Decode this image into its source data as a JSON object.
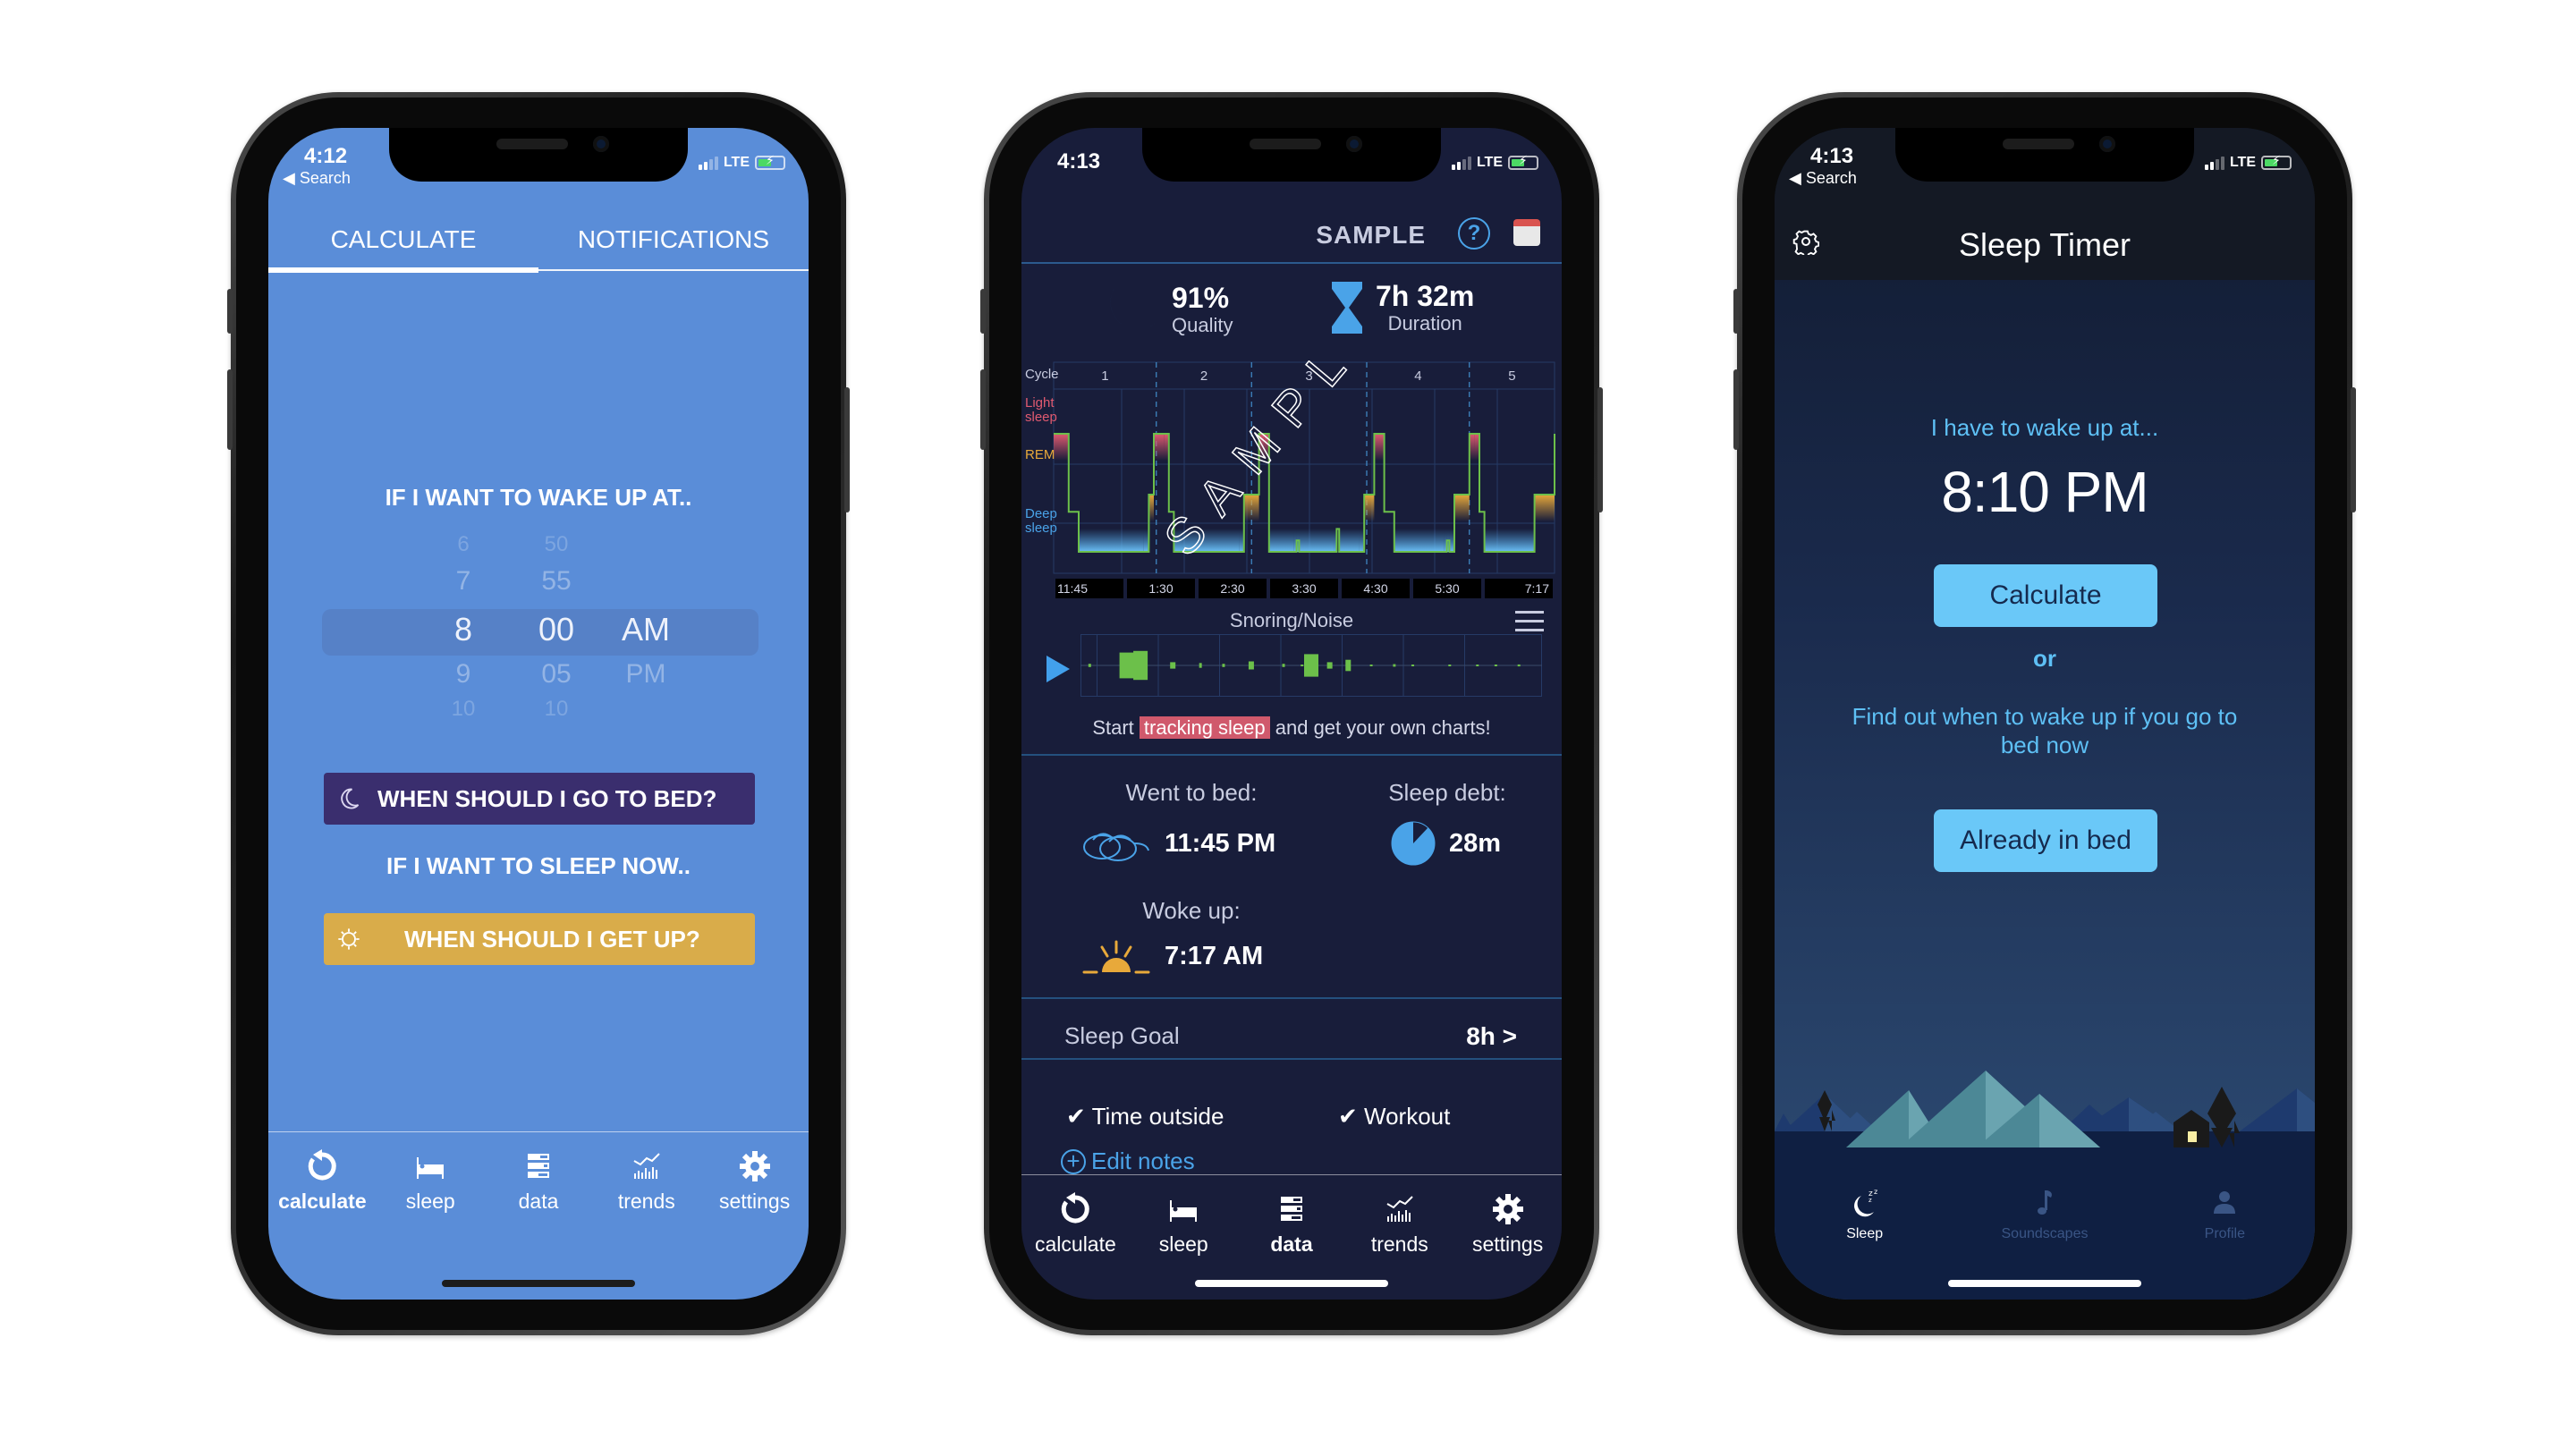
{
  "phones": {
    "calculator": {
      "status": {
        "time": "4:12",
        "back": "◀ Search",
        "network": "LTE"
      },
      "tabs": [
        {
          "label": "CALCULATE",
          "active": true
        },
        {
          "label": "NOTIFICATIONS",
          "active": false
        }
      ],
      "wake_heading": "IF I WANT TO WAKE UP AT..",
      "picker": {
        "hours": [
          "6",
          "7",
          "8",
          "9",
          "10"
        ],
        "minutes": [
          "50",
          "55",
          "00",
          "05",
          "10"
        ],
        "period": [
          "AM",
          "PM"
        ],
        "selected": {
          "hour": "8",
          "minute": "00",
          "period": "AM"
        }
      },
      "bed_button": "WHEN SHOULD I GO TO BED?",
      "sleep_now_heading": "IF I WANT TO SLEEP NOW..",
      "getup_button": "WHEN SHOULD I GET UP?",
      "colors": {
        "background": "#5a8dd8",
        "bed_button": "#3a2e6e",
        "getup_button": "#d9ac4a"
      },
      "tabbar": [
        {
          "label": "calculate",
          "icon": "refresh-icon",
          "active": true
        },
        {
          "label": "sleep",
          "icon": "bed-icon",
          "active": false
        },
        {
          "label": "data",
          "icon": "data-icon",
          "active": false
        },
        {
          "label": "trends",
          "icon": "trends-icon",
          "active": false
        },
        {
          "label": "settings",
          "icon": "gear-icon",
          "active": false
        }
      ]
    },
    "data": {
      "status": {
        "time": "4:13",
        "network": "LTE"
      },
      "title": "SAMPLE",
      "help": "?",
      "quality": {
        "value": "91%",
        "label": "Quality"
      },
      "duration": {
        "value": "7h 32m",
        "label": "Duration"
      },
      "hypnogram": {
        "cycle_label": "Cycle",
        "cycles": [
          "1",
          "2",
          "3",
          "4",
          "5"
        ],
        "stage_labels": [
          {
            "label": "Light\nsleep",
            "line1": "Light",
            "line2": "sleep",
            "color": "#e05a70"
          },
          {
            "label": "REM",
            "line1": "REM",
            "line2": "",
            "color": "#e8a93a"
          },
          {
            "label": "Deep\nsleep",
            "line1": "Deep",
            "line2": "sleep",
            "color": "#4aa3e8"
          }
        ],
        "time_ticks": [
          "11:45",
          "1:30",
          "2:30",
          "3:30",
          "4:30",
          "5:30",
          "7:17"
        ],
        "watermark": "SAMPLE",
        "stages": [
          [
            0,
            0
          ],
          [
            0.03,
            1.3
          ],
          [
            0.05,
            2
          ],
          [
            0.18,
            2
          ],
          [
            0.19,
            1
          ],
          [
            0.2,
            0
          ],
          [
            0.22,
            0
          ],
          [
            0.23,
            1.3
          ],
          [
            0.24,
            2
          ],
          [
            0.37,
            2
          ],
          [
            0.38,
            1
          ],
          [
            0.41,
            0
          ],
          [
            0.42,
            0
          ],
          [
            0.43,
            2
          ],
          [
            0.48,
            2
          ],
          [
            0.485,
            1.8
          ],
          [
            0.49,
            2
          ],
          [
            0.56,
            2
          ],
          [
            0.565,
            1.6
          ],
          [
            0.57,
            2
          ],
          [
            0.61,
            2
          ],
          [
            0.62,
            1
          ],
          [
            0.64,
            0
          ],
          [
            0.65,
            0
          ],
          [
            0.66,
            1.3
          ],
          [
            0.68,
            2
          ],
          [
            0.78,
            2
          ],
          [
            0.785,
            1.8
          ],
          [
            0.79,
            2
          ],
          [
            0.8,
            1
          ],
          [
            0.83,
            0
          ],
          [
            0.84,
            0
          ],
          [
            0.85,
            1.3
          ],
          [
            0.86,
            2
          ],
          [
            0.95,
            2
          ],
          [
            0.96,
            1
          ],
          [
            1.0,
            0
          ]
        ]
      },
      "snoring": {
        "label": "Snoring/Noise",
        "events": [
          0.02,
          0.1,
          0.13,
          0.2,
          0.26,
          0.31,
          0.37,
          0.44,
          0.48,
          0.5,
          0.54,
          0.58,
          0.63,
          0.68,
          0.72,
          0.8,
          0.86,
          0.9,
          0.95
        ],
        "amplitudes": [
          0.1,
          0.8,
          0.9,
          0.2,
          0.15,
          0.1,
          0.25,
          0.1,
          0.05,
          0.7,
          0.2,
          0.35,
          0.05,
          0.08,
          0.04,
          0.03,
          0.04,
          0.03,
          0.06
        ]
      },
      "cta": {
        "before": "Start ",
        "highlight": "tracking sleep",
        "after": " and get your own charts!"
      },
      "went_to_bed": {
        "label": "Went to bed:",
        "value": "11:45 PM"
      },
      "sleep_debt": {
        "label": "Sleep debt:",
        "value": "28m",
        "fraction": 0.88
      },
      "woke_up": {
        "label": "Woke up:",
        "value": "7:17 AM"
      },
      "sleep_goal": {
        "label": "Sleep Goal",
        "value": "8h >"
      },
      "notes": [
        {
          "check": "✔",
          "label": "Time outside"
        },
        {
          "check": "✔",
          "label": "Workout"
        }
      ],
      "edit_notes": "Edit notes",
      "tabbar": [
        {
          "label": "calculate",
          "icon": "refresh-icon",
          "active": false
        },
        {
          "label": "sleep",
          "icon": "bed-icon",
          "active": false
        },
        {
          "label": "data",
          "icon": "data-icon",
          "active": true
        },
        {
          "label": "trends",
          "icon": "trends-icon",
          "active": false
        },
        {
          "label": "settings",
          "icon": "gear-icon",
          "active": false
        }
      ]
    },
    "timer": {
      "status": {
        "time": "4:13",
        "back": "◀ Search",
        "network": "LTE"
      },
      "title": "Sleep Timer",
      "wake_prompt": "I have to wake up at...",
      "wake_time": "8:10 PM",
      "calculate_button": "Calculate",
      "or": "or",
      "bed_now_text": "Find out when to wake up if you go to bed now",
      "already_button": "Already in bed",
      "tabbar": [
        {
          "label": "Sleep",
          "icon": "moon-zzz-icon",
          "active": true
        },
        {
          "label": "Soundscapes",
          "icon": "music-note-icon",
          "active": false
        },
        {
          "label": "Profile",
          "icon": "person-icon",
          "active": false
        }
      ]
    }
  }
}
